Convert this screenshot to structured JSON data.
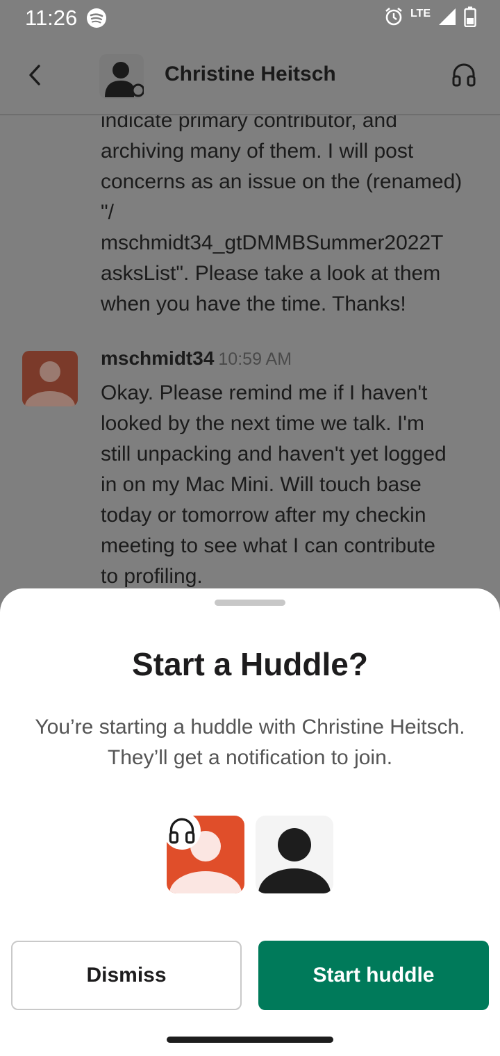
{
  "status_bar": {
    "time": "11:26",
    "network": "LTE",
    "icons": [
      "spotify-icon",
      "alarm-icon",
      "signal-icon",
      "battery-icon"
    ]
  },
  "header": {
    "title": "Christine Heitsch",
    "icons": [
      "back-arrow-icon",
      "avatar-icon",
      "headphones-icon"
    ]
  },
  "messages": [
    {
      "text": "indicate primary contributor, and\narchiving many of them.  I will post\nconcerns as an issue on the (renamed)\n\"/\nmschmidt34_gtDMMBSummer2022T\nasksList\".   Please take a look at them\nwhen you have the time.  Thanks!"
    },
    {
      "author": "mschmidt34",
      "time": "10:59 AM",
      "text": "Okay. Please remind me if I haven't\nlooked by the next time we talk. I'm\nstill unpacking and haven't yet logged\nin on my Mac Mini. Will touch base\ntoday or tomorrow after my checkin\nmeeting to see what I can contribute\nto profiling."
    }
  ],
  "sheet": {
    "title": "Start a Huddle?",
    "description_line1": "You’re starting a huddle with Christine Heitsch.",
    "description_line2": "They’ll get a notification to join.",
    "dismiss_label": "Dismiss",
    "start_label": "Start huddle"
  },
  "colors": {
    "primary_button": "#007a5a",
    "user_avatar": "#e04e2a",
    "overlay": "#7f7f7f"
  }
}
